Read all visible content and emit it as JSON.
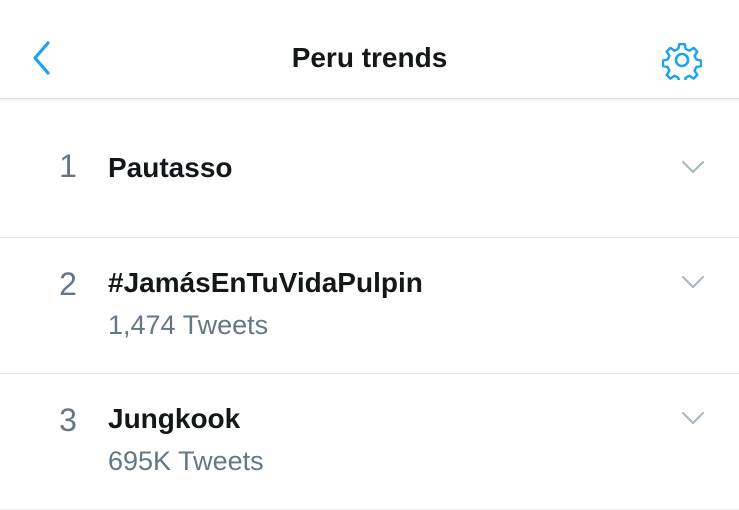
{
  "header": {
    "title": "Peru trends",
    "back_icon": "chevron-left-icon",
    "settings_icon": "gear-icon",
    "accent_color": "#1da1f2"
  },
  "trends": [
    {
      "rank": "1",
      "name": "Pautasso",
      "count": ""
    },
    {
      "rank": "2",
      "name": "#JamásEnTuVidaPulpin",
      "count": "1,474 Tweets"
    },
    {
      "rank": "3",
      "name": "Jungkook",
      "count": "695K Tweets"
    }
  ],
  "colors": {
    "text_primary": "#14171a",
    "text_secondary": "#657786",
    "divider": "#e1e8ed",
    "chevron": "#aab8c2"
  }
}
